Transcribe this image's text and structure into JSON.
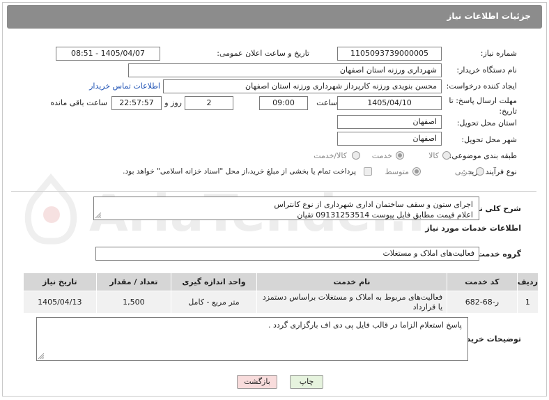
{
  "header": {
    "title": "جزئیات اطلاعات نیاز"
  },
  "fields": {
    "need_number_label": "شماره نیاز:",
    "need_number": "1105093739000005",
    "announce_label": "تاریخ و ساعت اعلان عمومی:",
    "announce_value": "1405/04/07 - 08:51",
    "buyer_org_label": "نام دستگاه خریدار:",
    "buyer_org": "شهرداری ورزنه استان اصفهان",
    "creator_label": "ایجاد کننده درخواست:",
    "creator": "محسن بنویدی ورزنه کارپرداز شهرداری ورزنه استان اصفهان",
    "contact_link": "اطلاعات تماس خریدار",
    "deadline_label": "مهلت ارسال پاسخ: تا تاریخ:",
    "deadline_date": "1405/04/10",
    "time_label": "ساعت",
    "deadline_time": "09:00",
    "days_value": "2",
    "days_label": "روز و",
    "remaining_time": "22:57:57",
    "remaining_label": "ساعت باقی مانده",
    "province_label": "استان محل تحویل:",
    "province": "اصفهان",
    "city_label": "شهر محل تحویل:",
    "city": "اصفهان",
    "category_label": "طبقه بندی موضوعی:",
    "category_options": [
      "کالا",
      "خدمت",
      "کالا/خدمت"
    ],
    "purchase_label": "نوع فرآیند خرید :",
    "purchase_options": [
      "جزیی",
      "متوسط"
    ],
    "payment_note": "پرداخت تمام یا بخشی از مبلغ خرید،از محل \"اسناد خزانه اسلامی\" خواهد بود."
  },
  "summary": {
    "label": "شرح کلی نیاز:",
    "line1": "اجرای ستون و سقف ساختمان اداری شهرداری از نوع کانتراس",
    "line2": "اعلام قیمت مطابق فایل پیوست  09131253514  تقیان"
  },
  "services": {
    "title": "اطلاعات خدمات مورد نیاز",
    "group_label": "گروه خدمت:",
    "group_value": "فعالیت‌های  املاک و مستغلات"
  },
  "table": {
    "headers": [
      "ردیف",
      "کد خدمت",
      "نام خدمت",
      "واحد اندازه گیری",
      "تعداد / مقدار",
      "تاریخ نیاز"
    ],
    "rows": [
      {
        "index": "1",
        "code": "ر-68-682",
        "name": "فعالیت‌های مربوط به املاک و مستغلات براساس دستمزد یا قرارداد",
        "unit": "متر مربع - کامل",
        "qty": "1,500",
        "date": "1405/04/13"
      }
    ]
  },
  "buyer_notes": {
    "label": "توضیحات خریدار:",
    "text": "پاسخ استعلام الزاما در قالب فایل پی دی اف بارگزاری گردد ."
  },
  "buttons": {
    "print": "چاپ",
    "back": "بازگشت"
  },
  "watermark": {
    "text": "AriaTender.neT"
  },
  "colors": {
    "header_bg": "#8c8c8c",
    "link": "#1b4fb3",
    "back_bg": "#f8dcdc",
    "print_bg": "#e6f3de"
  }
}
